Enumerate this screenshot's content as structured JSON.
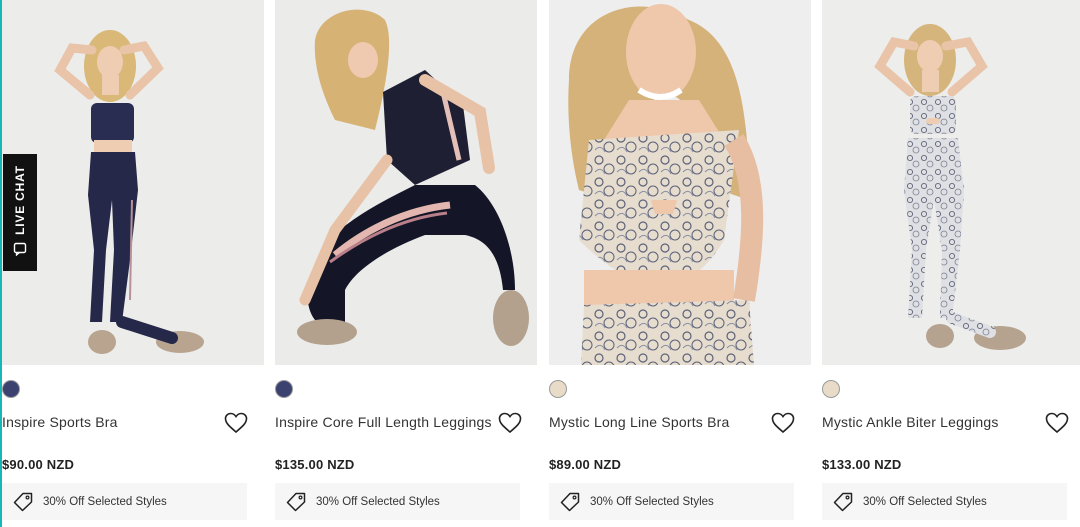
{
  "live_chat": {
    "label": "LIVE CHAT",
    "icon": "chat-bubble-icon"
  },
  "colors": {
    "accent_border": "#18b6b6",
    "navy_swatch": "#3c4270",
    "cream_swatch": "#e8dcc8",
    "promo_bg": "#f6f6f6"
  },
  "products": [
    {
      "name": "Inspire Sports Bra",
      "price": "$90.00 NZD",
      "promo": "30% Off Selected Styles",
      "swatch_color": "#3c4270",
      "image": "model-navy-sports-bra-and-leggings",
      "wishlist_icon": "heart-icon",
      "promo_icon": "price-tag-icon"
    },
    {
      "name": "Inspire Core Full Length Leggings",
      "price": "$135.00 NZD",
      "promo": "30% Off Selected Styles",
      "swatch_color": "#3c4270",
      "image": "model-kneeling-striped-leggings",
      "wishlist_icon": "heart-icon",
      "promo_icon": "price-tag-icon"
    },
    {
      "name": "Mystic Long Line Sports Bra",
      "price": "$89.00 NZD",
      "promo": "30% Off Selected Styles",
      "swatch_color": "#e8dcc8",
      "image": "model-floral-long-line-bra-closeup",
      "wishlist_icon": "heart-icon",
      "promo_icon": "price-tag-icon"
    },
    {
      "name": "Mystic Ankle Biter Leggings",
      "price": "$133.00 NZD",
      "promo": "30% Off Selected Styles",
      "swatch_color": "#e8dcc8",
      "image": "model-floral-ankle-biter-leggings",
      "wishlist_icon": "heart-icon",
      "promo_icon": "price-tag-icon"
    }
  ]
}
